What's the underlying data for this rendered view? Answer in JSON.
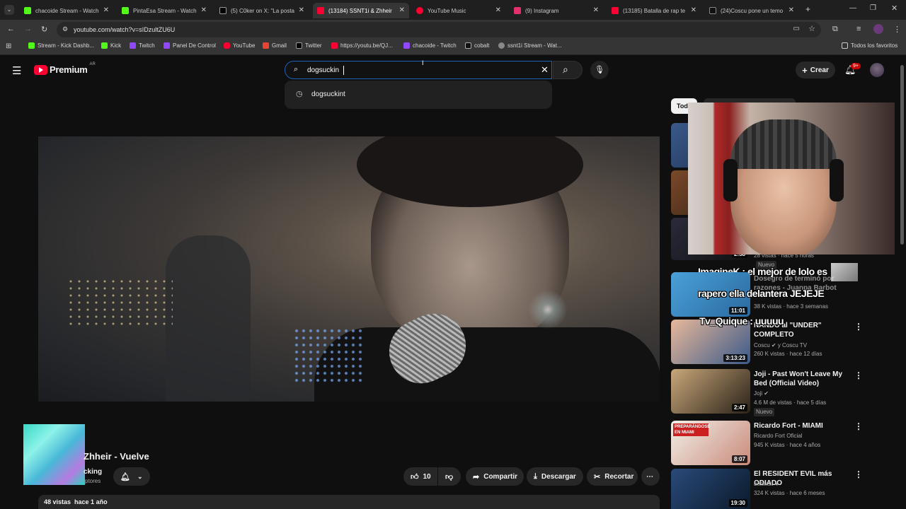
{
  "browser": {
    "tabs": [
      {
        "label": "chacoide Stream - Watch",
        "color": "#53fc18"
      },
      {
        "label": "PintaEsa Stream - Watch",
        "color": "#53fc18"
      },
      {
        "label": "(5) C0ker on X: \"La posta",
        "color": "#ffffff"
      },
      {
        "label": "(13184) SSNT1i & Zhheir",
        "color": "#ff0033"
      },
      {
        "label": "YouTube Music",
        "color": "#ff0033"
      },
      {
        "label": "(9) Instagram",
        "color": "#e1306c"
      },
      {
        "label": "(13185) Batalla de rap te",
        "color": "#ff0033"
      },
      {
        "label": "(24)Coscu pone un temo",
        "color": "#ffffff"
      }
    ],
    "url": "youtube.com/watch?v=sIDzultZU6U",
    "bookmarks": [
      {
        "label": "Stream - Kick Dashb...",
        "color": "#53fc18"
      },
      {
        "label": "Kick",
        "color": "#53fc18"
      },
      {
        "label": "Twitch",
        "color": "#9146ff"
      },
      {
        "label": "Panel De Control",
        "color": "#9146ff"
      },
      {
        "label": "YouTube",
        "color": "#ff0033"
      },
      {
        "label": "Gmail",
        "color": "#ea4335"
      },
      {
        "label": "Twitter",
        "color": "#ffffff"
      },
      {
        "label": "https://youtu.be/QJ...",
        "color": "#ff0033"
      },
      {
        "label": "chacoide - Twitch",
        "color": "#9146ff"
      },
      {
        "label": "cobalt",
        "color": "#ffffff"
      },
      {
        "label": "ssnt1i Stream - Wat...",
        "color": "#aaaaaa"
      }
    ],
    "bookmarks_all": "Todos los favoritos"
  },
  "youtube": {
    "logo": "Premium",
    "region": "AR",
    "search_value": "dogsuckin",
    "suggestion": "dogsuckint",
    "create_label": "Crear",
    "notif_badge": "9+",
    "chip_all": "Todo"
  },
  "video": {
    "title": "Zhheir - Vuelve",
    "channel_partial": "cking",
    "subs_partial": "ptores",
    "likes": "10",
    "share": "Compartir",
    "download": "Descargar",
    "clip": "Recortar",
    "views": "48 vistas",
    "age": "hace 1 año"
  },
  "overlay": {
    "line1": "ImagineK : el mejor de lolo es",
    "line2": "rapero ella delantera JEJEJE",
    "line3": "Tv_Quique : uuuuu"
  },
  "recommendations": [
    {
      "duration": "2:58",
      "meta1": "28 vistas · hace 5 horas",
      "meta2": "Nuevo"
    },
    {
      "title": "Dosegro de terminó por razones - Juanpa Barbot",
      "meta1": "38 K vistas · hace 3 semanas",
      "duration": "11:01"
    },
    {
      "title": "NANDO al \"UNDER\" COMPLETO",
      "channel": "Coscu ✔ y Coscu TV",
      "meta1": "260 K vistas · hace 12 días",
      "duration": "3:13:23"
    },
    {
      "title": "Joji - Past Won't Leave My Bed (Official Video)",
      "channel": "Joji ✔",
      "meta1": "4.6 M de vistas · hace 5 días",
      "badge": "Nuevo",
      "duration": "2:47"
    },
    {
      "title": "Ricardo Fort - MIAMI",
      "channel": "Ricardo Fort Oficial",
      "meta1": "945 K vistas · hace 4 años",
      "duration": "8:07",
      "thumb_text": "PREPARÁNDOSE EN MIAMI"
    },
    {
      "title": "El RESIDENT EVIL más ODIADO",
      "channel": "beltwait ◂",
      "meta1": "324 K vistas · hace 6 meses",
      "duration": "19:30"
    }
  ]
}
